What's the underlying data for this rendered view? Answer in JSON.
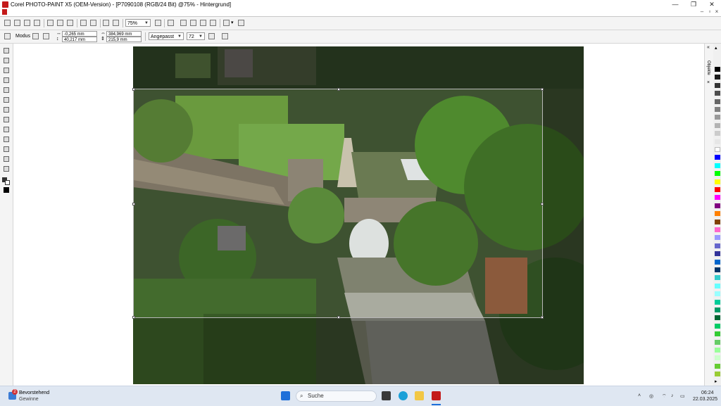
{
  "window": {
    "title": "Corel PHOTO-PAINT X5 (OEM-Version) - [P7090108 (RGB/24 Bit) @75% - Hintergrund]",
    "minimize_glyph": "—",
    "maximize_glyph": "❐",
    "close_glyph": "✕",
    "doc_minimize_glyph": "–",
    "doc_restore_glyph": "▫",
    "doc_close_glyph": "×"
  },
  "toolbar": {
    "zoom_value": "75%"
  },
  "property_bar": {
    "mode_label": "Modus",
    "pos_x": "-0,265 mm",
    "pos_y": "40,217 mm",
    "width": "384,969 mm",
    "height": "215,9 mm",
    "fit_value": "Angepasst",
    "resolution_value": "72"
  },
  "docker": {
    "tab_label": "Objekte"
  },
  "palette": {
    "colors": [
      "#000000",
      "#1a1a1a",
      "#333333",
      "#4d4d4d",
      "#666666",
      "#808080",
      "#999999",
      "#b3b3b3",
      "#cccccc",
      "#e6e6e6",
      "#ffffff",
      "#0000ff",
      "#00ffff",
      "#00ff00",
      "#ffff00",
      "#ff0000",
      "#ff00ff",
      "#800080",
      "#ff8000",
      "#804000",
      "#ff66cc",
      "#9999ff",
      "#6666cc",
      "#333399",
      "#0066cc",
      "#003366",
      "#33cccc",
      "#66ffff",
      "#99ffff",
      "#00cc99",
      "#009966",
      "#006633",
      "#00cc66",
      "#33cc33",
      "#66cc66",
      "#99ff99",
      "#ccffcc",
      "#66cc33",
      "#99cc33"
    ]
  },
  "taskbar": {
    "notification_count": "2",
    "widget_title": "Bevorstehend",
    "widget_subtitle": "Gewinne",
    "search_placeholder": "Suche",
    "time": "06:24",
    "date": "22.03.2025"
  }
}
